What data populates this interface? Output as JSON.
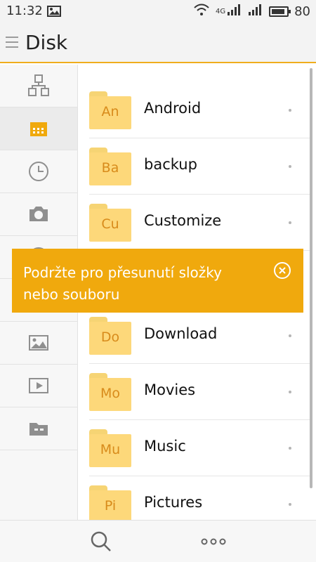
{
  "status_bar": {
    "time": "11:32",
    "network_label": "4G",
    "battery_level": "80",
    "icons": [
      "image-icon",
      "wifi-icon",
      "cellular-signal-icon",
      "battery-icon"
    ]
  },
  "header": {
    "title": "Disk",
    "menu_icon": "menu-icon"
  },
  "sidebar": {
    "items": [
      {
        "name": "network-icon",
        "active": false
      },
      {
        "name": "storage-card-icon",
        "active": true
      },
      {
        "name": "clock-icon",
        "active": false
      },
      {
        "name": "camera-icon",
        "active": false
      },
      {
        "name": "music-icon",
        "active": false
      },
      {
        "name": "image-icon",
        "active": false
      },
      {
        "name": "video-icon",
        "active": false
      },
      {
        "name": "package-icon",
        "active": false
      }
    ]
  },
  "file_list": {
    "items": [
      {
        "abbr": "An",
        "name": "Android"
      },
      {
        "abbr": "Ba",
        "name": "backup"
      },
      {
        "abbr": "Cu",
        "name": "Customize"
      },
      {
        "abbr": "Do",
        "name": "Download"
      },
      {
        "abbr": "Mo",
        "name": "Movies"
      },
      {
        "abbr": "Mu",
        "name": "Music"
      },
      {
        "abbr": "Pi",
        "name": "Pictures"
      }
    ]
  },
  "toast": {
    "message": "Podržte pro přesunutí složky nebo souboru",
    "close_icon": "close-circle-icon"
  },
  "bottom_bar": {
    "search_icon": "search-icon",
    "more_icon": "more-icon"
  },
  "colors": {
    "accent": "#f0a90d",
    "folder": "#fdd87a",
    "folder_label": "#d88b1b",
    "sidebar_icon": "#8f8f8f",
    "active_icon": "#f0a90d"
  }
}
